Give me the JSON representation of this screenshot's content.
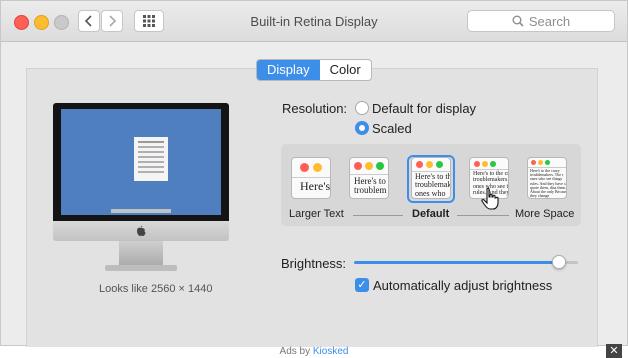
{
  "window": {
    "title": "Built-in Retina Display"
  },
  "toolbar": {
    "search_placeholder": "Search"
  },
  "colors": {
    "accent": "#3d8ee9",
    "close": "#fe5f57",
    "minimize": "#febc2e",
    "zoom": "#c9c9c9",
    "desktop": "#4f7fbf"
  },
  "icons": {
    "back": "chevron-left-icon",
    "forward": "chevron-right-icon",
    "grid": "grid-icon",
    "search": "magnifier-icon",
    "apple": "apple-logo-icon",
    "close_ad": "close-icon"
  },
  "tabs": [
    {
      "label": "Display",
      "selected": true
    },
    {
      "label": "Color",
      "selected": false
    }
  ],
  "preview": {
    "caption": "Looks like 2560 × 1440"
  },
  "resolution": {
    "label": "Resolution:",
    "options": [
      {
        "label": "Default for display",
        "selected": false
      },
      {
        "label": "Scaled",
        "selected": true
      }
    ]
  },
  "scaling": {
    "labels": {
      "larger": "Larger Text",
      "default": "Default",
      "more": "More Space"
    },
    "selected_index": 2,
    "previews": [
      {
        "text": "Here's"
      },
      {
        "text": "Here's to troublem"
      },
      {
        "text": "Here's to th troublemak ones who"
      },
      {
        "text": "Here's to the cr troublemakers. ones who see t rules. And they"
      },
      {
        "text": "Here's to the crazy troublemakers. The r ones who see things rules. And they have can quote them, disa them. About the only Because they change"
      }
    ]
  },
  "brightness": {
    "label": "Brightness:",
    "value": 0.92,
    "auto_label": "Automatically adjust brightness",
    "auto_checked": true
  },
  "ads": {
    "prefix": "Ads by",
    "brand": "Kiosked",
    "close": "✕"
  }
}
